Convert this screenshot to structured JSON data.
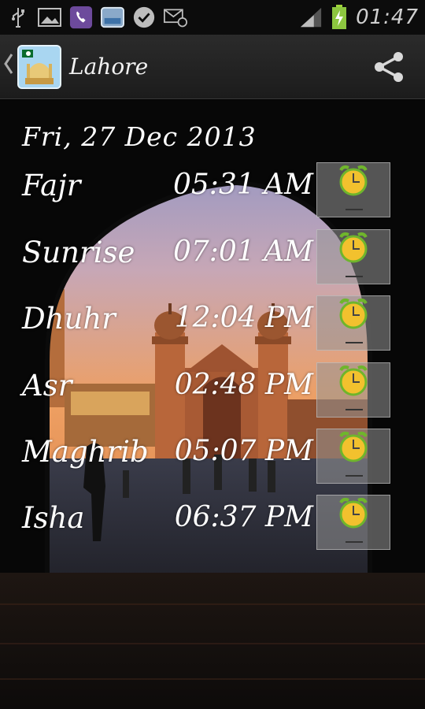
{
  "status_bar": {
    "time": "01:47",
    "icons": [
      "usb-icon",
      "gallery-icon",
      "viber-icon",
      "app-icon",
      "bbm-icon",
      "email-icon",
      "signal-icon",
      "battery-charging-icon"
    ]
  },
  "action_bar": {
    "title": "Lahore",
    "share_icon": "share-icon"
  },
  "date": "Fri, 27 Dec 2013",
  "prayers": [
    {
      "name": "Fajr",
      "time": "05:31 AM"
    },
    {
      "name": "Sunrise",
      "time": "07:01 AM"
    },
    {
      "name": "Dhuhr",
      "time": "12:04 PM"
    },
    {
      "name": "Asr",
      "time": "02:48 PM"
    },
    {
      "name": "Maghrib",
      "time": "05:07 PM"
    },
    {
      "name": "Isha",
      "time": "06:37 PM"
    }
  ],
  "colors": {
    "alarm_clock": "#f2c12e",
    "alarm_clock_ring": "#6fb52c",
    "sky_top": "#7f8fc9",
    "sky_bottom": "#e9a36a"
  }
}
